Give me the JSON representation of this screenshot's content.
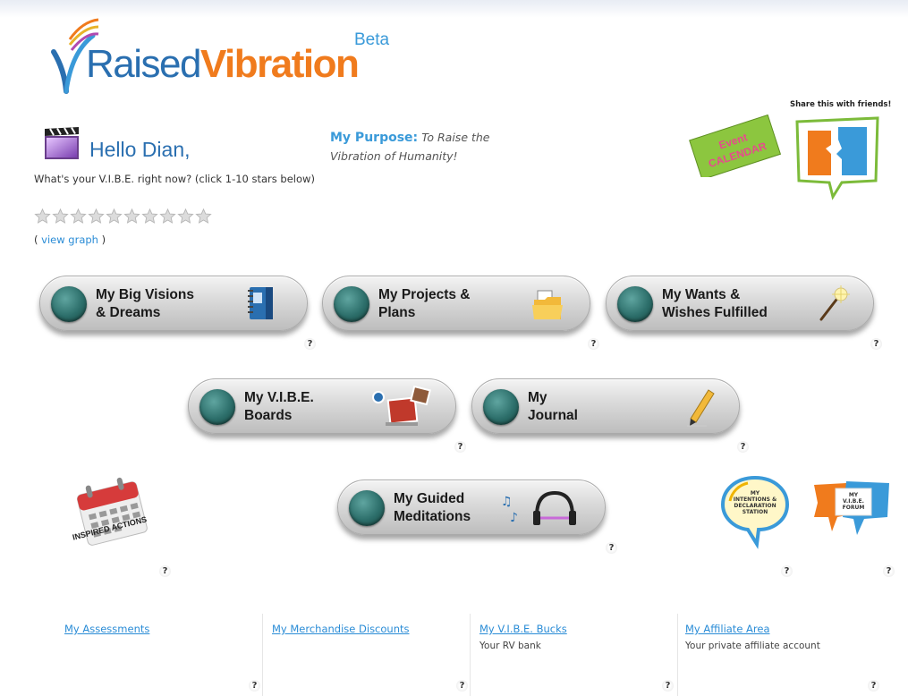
{
  "logo": {
    "word_a": "Raised",
    "word_b": "Vibration",
    "beta": "Beta"
  },
  "greeting": {
    "hello": "Hello Dian,",
    "question": "What's your V.I.B.E. right now? (click 1-10 stars below)",
    "star_count": 10,
    "view_graph_open": "( ",
    "view_graph": "view graph",
    "view_graph_close": " )"
  },
  "purpose": {
    "label": "My Purpose:",
    "text": "To Raise the Vibration of Humanity!"
  },
  "badges": {
    "event_calendar": "Event\nCALENDAR",
    "share": "Share this with friends!"
  },
  "buttons": [
    {
      "label": "My Big Visions\n& Dreams",
      "icon": "notebook-icon"
    },
    {
      "label": "My Projects &\nPlans",
      "icon": "folder-icon"
    },
    {
      "label": "My Wants &\nWishes Fulfilled",
      "icon": "magic-wand-icon"
    },
    {
      "label": "My V.I.B.E.\nBoards",
      "icon": "vision-board-icon"
    },
    {
      "label": "My\nJournal",
      "icon": "pencil-icon"
    },
    {
      "label": "My Guided\nMeditations",
      "icon": "headphones-icon"
    }
  ],
  "help": "?",
  "inspired_actions": "INSPIRED ACTIONS",
  "intentions_station": "MY\nINTENTIONS &\nDECLARATION\nSTATION",
  "vibe_forum": "MY\nV.I.B.E.\nFORUM",
  "footer": [
    {
      "link": "My Assessments",
      "sub": ""
    },
    {
      "link": "My Merchandise Discounts",
      "sub": ""
    },
    {
      "link": "My V.I.B.E. Bucks",
      "sub": "Your RV bank"
    },
    {
      "link": "My Affiliate Area",
      "sub": "Your private affiliate account"
    }
  ],
  "colors": {
    "brand_blue": "#2a6fb0",
    "brand_orange": "#f07b1d",
    "link": "#2a8cd6",
    "orb": "#2c6e6a"
  }
}
